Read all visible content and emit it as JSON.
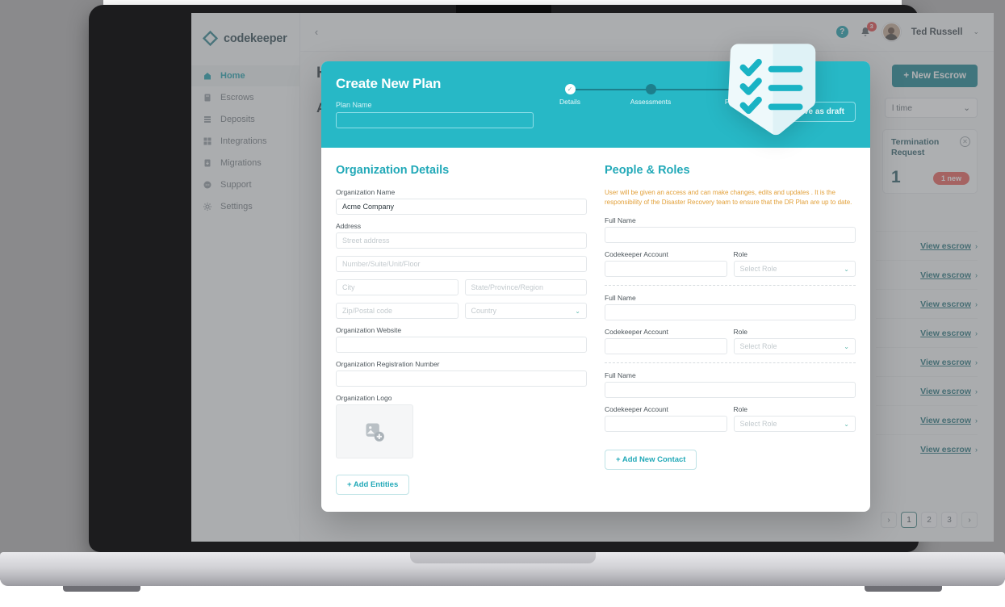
{
  "brand": {
    "name": "codekeeper",
    "logo_icon": "diamond-logo-icon"
  },
  "sidebar": {
    "items": [
      {
        "label": "Home",
        "icon": "home-icon",
        "active": true
      },
      {
        "label": "Escrows",
        "icon": "escrow-document-icon",
        "active": false
      },
      {
        "label": "Deposits",
        "icon": "deposits-stack-icon",
        "active": false
      },
      {
        "label": "Integrations",
        "icon": "integrations-grid-icon",
        "active": false
      },
      {
        "label": "Migrations",
        "icon": "migrations-icon",
        "active": false
      },
      {
        "label": "Support",
        "icon": "support-chat-icon",
        "active": false
      },
      {
        "label": "Settings",
        "icon": "gear-icon",
        "active": false
      }
    ]
  },
  "topbar": {
    "collapse_icon": "chevron-left-icon",
    "help_label": "?",
    "bell_icon": "bell-icon",
    "notification_count": "3",
    "user_name": "Ted Russell",
    "caret_icon": "chevron-down-icon"
  },
  "page": {
    "title": "H",
    "subtitle": "A",
    "new_escrow_label": "+ New Escrow",
    "range_value": "l time",
    "range_caret": "chevron-down-icon",
    "termination": {
      "title": "Termination Request",
      "count": "1",
      "badge": "1 new",
      "close_icon": "close-icon"
    },
    "escrow_rows": [
      {
        "link": "View escrow",
        "chevron": "›"
      },
      {
        "link": "View escrow",
        "chevron": "›"
      },
      {
        "link": "View escrow",
        "chevron": "›"
      },
      {
        "link": "View escrow",
        "chevron": "›"
      },
      {
        "link": "View escrow",
        "chevron": "›"
      },
      {
        "link": "View escrow",
        "chevron": "›"
      },
      {
        "link": "View escrow",
        "chevron": "›"
      },
      {
        "link": "View escrow",
        "chevron": "›"
      }
    ],
    "pagination": {
      "prev": "›",
      "pages": [
        "1",
        "2",
        "3"
      ],
      "active_page": "1",
      "next": "›"
    }
  },
  "modal": {
    "title": "Create New Plan",
    "plan_name_label": "Plan Name",
    "plan_name_value": "",
    "save_draft_label": "Save as draft",
    "steps": [
      {
        "label": "Details",
        "state": "done"
      },
      {
        "label": "Assessments",
        "state": "pending"
      },
      {
        "label": "Preview",
        "state": "pending"
      }
    ],
    "organization": {
      "heading": "Organization Details",
      "org_name_label": "Organization Name",
      "org_name_value": "Acme Company",
      "address_label": "Address",
      "street_placeholder": "Street address",
      "unit_placeholder": "Number/Suite/Unit/Floor",
      "city_placeholder": "City",
      "state_placeholder": "State/Province/Region",
      "zip_placeholder": "Zip/Postal code",
      "country_placeholder": "Country",
      "website_label": "Organization Website",
      "website_value": "",
      "reg_number_label": "Organization Registration Number",
      "reg_number_value": "",
      "logo_label": "Organization Logo",
      "logo_icon": "image-add-icon",
      "add_entities_label": "+ Add Entities"
    },
    "people": {
      "heading": "People & Roles",
      "warning": "User will be given an access and can make changes, edits and updates . It is the responsibility of the Disaster Recovery team to ensure that the DR Plan are up to date.",
      "full_name_label": "Full Name",
      "account_label": "Codekeeper Account",
      "role_label": "Role",
      "role_placeholder": "Select Role",
      "role_caret": "chevron-down-icon",
      "contacts": [
        {
          "full_name": "",
          "account": "",
          "role": "Select Role"
        },
        {
          "full_name": "",
          "account": "",
          "role": "Select Role"
        },
        {
          "full_name": "",
          "account": "",
          "role": "Select Role"
        }
      ],
      "add_contact_label": "+ Add New Contact"
    }
  },
  "decoration": {
    "badge_icon": "checklist-shield-icon"
  },
  "colors": {
    "teal": "#27b8c6",
    "teal_dark": "#0a7d89",
    "accent_heading": "#22a9b8",
    "warning": "#e2a03a",
    "danger": "#e8544f",
    "link": "#186b74"
  }
}
